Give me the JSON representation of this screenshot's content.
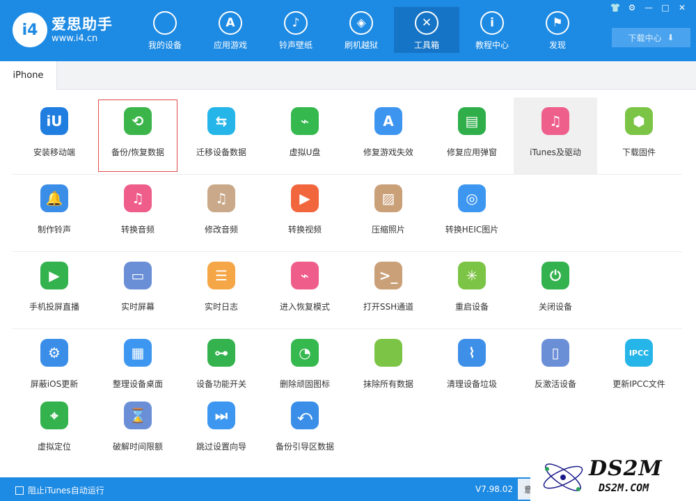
{
  "app": {
    "name": "爱思助手",
    "url": "www.i4.cn",
    "logo_text": "i4"
  },
  "nav": [
    {
      "label": "我的设备",
      "icon": "apple-icon",
      "glyph": "",
      "active": false
    },
    {
      "label": "应用游戏",
      "icon": "app-store-icon",
      "glyph": "A",
      "active": false
    },
    {
      "label": "铃声壁纸",
      "icon": "music-icon",
      "glyph": "♪",
      "active": false
    },
    {
      "label": "刷机越狱",
      "icon": "dropbox-icon",
      "glyph": "◈",
      "active": false
    },
    {
      "label": "工具箱",
      "icon": "tools-icon",
      "glyph": "✕",
      "active": true
    },
    {
      "label": "教程中心",
      "icon": "info-icon",
      "glyph": "i",
      "active": false
    },
    {
      "label": "发现",
      "icon": "flag-icon",
      "glyph": "⚑",
      "active": false
    }
  ],
  "window_controls": [
    "👕",
    "⚙",
    "—",
    "□",
    "✕"
  ],
  "download_center": {
    "label": "下载中心",
    "glyph": "⬇"
  },
  "tab": {
    "label": "iPhone"
  },
  "tools": [
    [
      {
        "label": "安装移动端",
        "icon": "i4-app-icon",
        "glyph": "iU",
        "color": "#1f7ee0"
      },
      {
        "label": "备份/恢复数据",
        "icon": "backup-restore-icon",
        "glyph": "⟲",
        "color": "#3bb54a",
        "selected": true
      },
      {
        "label": "迁移设备数据",
        "icon": "migrate-data-icon",
        "glyph": "⇆",
        "color": "#26b5e8"
      },
      {
        "label": "虚拟U盘",
        "icon": "usb-drive-icon",
        "glyph": "⌁",
        "color": "#35b84e"
      },
      {
        "label": "修复游戏失效",
        "icon": "fix-game-icon",
        "glyph": "A",
        "color": "#3d95ef"
      },
      {
        "label": "修复应用弹窗",
        "icon": "apple-id-icon",
        "glyph": "▤",
        "color": "#2fae4a"
      },
      {
        "label": "iTunes及驱动",
        "icon": "itunes-icon",
        "glyph": "♫",
        "color": "#ee5f8c",
        "highlight": true
      },
      {
        "label": "下载固件",
        "icon": "firmware-box-icon",
        "glyph": "⬢",
        "color": "#7cc445"
      }
    ],
    [
      {
        "label": "制作铃声",
        "icon": "bell-icon",
        "glyph": "🔔",
        "color": "#3a8ee8"
      },
      {
        "label": "转换音频",
        "icon": "music-note-icon",
        "glyph": "♫",
        "color": "#ef5d8a"
      },
      {
        "label": "修改音频",
        "icon": "edit-audio-icon",
        "glyph": "♫",
        "color": "#c9a98a"
      },
      {
        "label": "转换视频",
        "icon": "video-play-icon",
        "glyph": "▶",
        "color": "#f2663e"
      },
      {
        "label": "压缩照片",
        "icon": "photo-icon",
        "glyph": "▨",
        "color": "#c9a078"
      },
      {
        "label": "转换HEIC图片",
        "icon": "heic-image-icon",
        "glyph": "◎",
        "color": "#3d97f0"
      }
    ],
    [
      {
        "label": "手机投屏直播",
        "icon": "screen-cast-icon",
        "glyph": "▶",
        "color": "#33b24e"
      },
      {
        "label": "实时屏幕",
        "icon": "monitor-icon",
        "glyph": "▭",
        "color": "#6b8fd6"
      },
      {
        "label": "实时日志",
        "icon": "log-document-icon",
        "glyph": "☰",
        "color": "#f5a646"
      },
      {
        "label": "进入恢复模式",
        "icon": "recovery-mode-icon",
        "glyph": "⌁",
        "color": "#ef5d8a"
      },
      {
        "label": "打开SSH通道",
        "icon": "ssh-terminal-icon",
        "glyph": ">_",
        "color": "#c9a078"
      },
      {
        "label": "重启设备",
        "icon": "restart-icon",
        "glyph": "✳",
        "color": "#7cc445"
      },
      {
        "label": "关闭设备",
        "icon": "power-icon",
        "glyph": "⏻",
        "color": "#33b24e"
      }
    ],
    [
      {
        "label": "屏蔽iOS更新",
        "icon": "block-update-icon",
        "glyph": "⚙",
        "color": "#3a8ee8"
      },
      {
        "label": "整理设备桌面",
        "icon": "desktop-grid-icon",
        "glyph": "▦",
        "color": "#3d97f0"
      },
      {
        "label": "设备功能开关",
        "icon": "toggle-switch-icon",
        "glyph": "⊶",
        "color": "#33b24e"
      },
      {
        "label": "删除顽固图标",
        "icon": "pie-delete-icon",
        "glyph": "◔",
        "color": "#35b84e"
      },
      {
        "label": "抹除所有数据",
        "icon": "erase-data-icon",
        "glyph": "",
        "color": "#7cc445"
      },
      {
        "label": "清理设备垃圾",
        "icon": "broom-icon",
        "glyph": "⌇",
        "color": "#3d8fe8"
      },
      {
        "label": "反激活设备",
        "icon": "deactivate-device-icon",
        "glyph": "▯",
        "color": "#6b8fd6"
      },
      {
        "label": "更新IPCC文件",
        "icon": "ipcc-icon",
        "glyph": "IPCC",
        "color": "#26b5e8"
      }
    ],
    [
      {
        "label": "虚拟定位",
        "icon": "location-pin-icon",
        "glyph": "⌖",
        "color": "#33b24e"
      },
      {
        "label": "破解时间限额",
        "icon": "hourglass-icon",
        "glyph": "⌛",
        "color": "#6b8fd6"
      },
      {
        "label": "跳过设置向导",
        "icon": "skip-wizard-icon",
        "glyph": "⏭",
        "color": "#3d97f0"
      },
      {
        "label": "备份引导区数据",
        "icon": "boot-backup-icon",
        "glyph": "⤺",
        "color": "#3a8ee8"
      }
    ]
  ],
  "statusbar": {
    "itunes_autorun": "阻止iTunes自动运行",
    "version": "V7.98.02",
    "extra": "意"
  },
  "watermark": {
    "main": "DS2M",
    "sub": "DS2M.COM"
  }
}
